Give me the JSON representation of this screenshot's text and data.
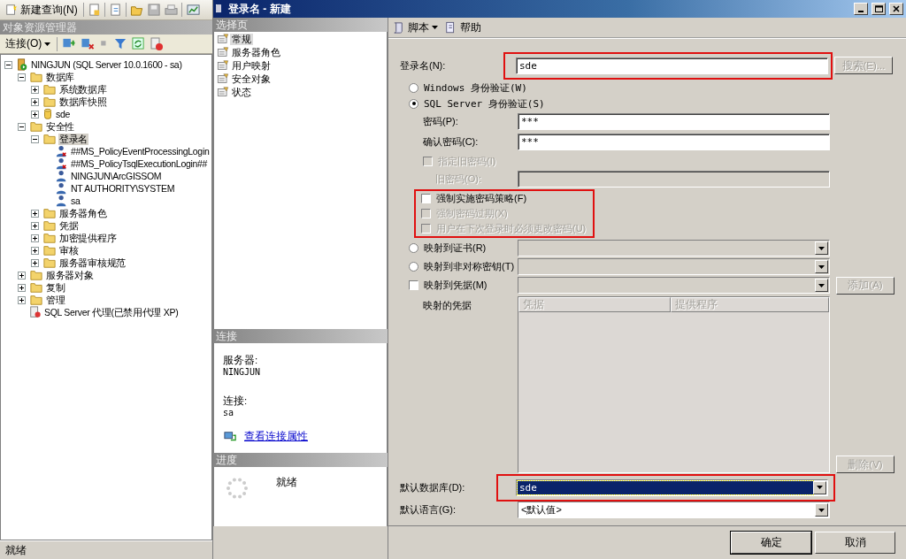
{
  "main_toolbar": {
    "new_query": "新建查询(N)"
  },
  "explorer": {
    "title": "对象资源管理器",
    "connect": "连接(O)",
    "tree": [
      {
        "kind": "server",
        "label": "NINGJUN (SQL Server 10.0.1600 - sa)",
        "expanded": true,
        "selected": false,
        "children": [
          {
            "kind": "folder",
            "label": "数据库",
            "expanded": true,
            "selected": false,
            "children": [
              {
                "kind": "folder",
                "label": "系统数据库",
                "expanded": false,
                "selected": false
              },
              {
                "kind": "folder",
                "label": "数据库快照",
                "expanded": false,
                "selected": false
              },
              {
                "kind": "database",
                "label": "sde",
                "expanded": false,
                "selected": false
              }
            ]
          },
          {
            "kind": "folder",
            "label": "安全性",
            "expanded": true,
            "selected": false,
            "children": [
              {
                "kind": "folder",
                "label": "登录名",
                "expanded": true,
                "selected": true,
                "children": [
                  {
                    "kind": "login-disabled",
                    "label": "##MS_PolicyEventProcessingLogin",
                    "selected": false
                  },
                  {
                    "kind": "login-disabled",
                    "label": "##MS_PolicyTsqlExecutionLogin##",
                    "selected": false
                  },
                  {
                    "kind": "login",
                    "label": "NINGJUN\\ArcGISSOM",
                    "selected": false
                  },
                  {
                    "kind": "login",
                    "label": "NT AUTHORITY\\SYSTEM",
                    "selected": false
                  },
                  {
                    "kind": "login",
                    "label": "sa",
                    "selected": false
                  }
                ]
              },
              {
                "kind": "folder",
                "label": "服务器角色",
                "expanded": false,
                "selected": false
              },
              {
                "kind": "folder",
                "label": "凭据",
                "expanded": false,
                "selected": false
              },
              {
                "kind": "folder",
                "label": "加密提供程序",
                "expanded": false,
                "selected": false
              },
              {
                "kind": "folder",
                "label": "审核",
                "expanded": false,
                "selected": false
              },
              {
                "kind": "folder",
                "label": "服务器审核规范",
                "expanded": false,
                "selected": false
              }
            ]
          },
          {
            "kind": "folder",
            "label": "服务器对象",
            "expanded": false,
            "selected": false
          },
          {
            "kind": "folder",
            "label": "复制",
            "expanded": false,
            "selected": false
          },
          {
            "kind": "folder",
            "label": "管理",
            "expanded": false,
            "selected": false
          },
          {
            "kind": "agent",
            "label": "SQL Server 代理(已禁用代理 XP)",
            "selected": false
          }
        ]
      }
    ]
  },
  "status_bar": "就绪",
  "dialog": {
    "title": "登录名 - 新建",
    "pages_header": "选择页",
    "pages": [
      {
        "label": "常规",
        "selected": true
      },
      {
        "label": "服务器角色",
        "selected": false
      },
      {
        "label": "用户映射",
        "selected": false
      },
      {
        "label": "安全对象",
        "selected": false
      },
      {
        "label": "状态",
        "selected": false
      }
    ],
    "connection_header": "连接",
    "server_label": "服务器:",
    "server": "NINGJUN",
    "connection_label": "连接:",
    "connection": "sa",
    "connection_link": "查看连接属性",
    "progress_header": "进度",
    "progress_status": "就绪"
  },
  "toolbar": {
    "script": "脚本",
    "help": "帮助"
  },
  "form": {
    "login_name": {
      "label": "登录名(N):",
      "value": "sde",
      "highlighted": true
    },
    "search_button": {
      "label": "搜索(E)...",
      "disabled": true
    },
    "auth_modes": [
      {
        "label": "Windows 身份验证(W)",
        "selected": false
      },
      {
        "label": "SQL Server 身份验证(S)",
        "selected": true
      }
    ],
    "password": {
      "label": "密码(P):",
      "value": "***"
    },
    "confirm_password": {
      "label": "确认密码(C):",
      "value": "***"
    },
    "specify_old_password": {
      "label": "指定旧密码(I)",
      "checked": false,
      "disabled": true
    },
    "old_password": {
      "label": "旧密码(O):",
      "disabled": true
    },
    "policy_highlighted": true,
    "policy_options": [
      {
        "label": "强制实施密码策略(F)",
        "checked": false,
        "disabled": false
      },
      {
        "label": "强制密码过期(X)",
        "checked": false,
        "disabled": true
      },
      {
        "label": "用户在下次登录时必须更改密码(U)",
        "checked": false,
        "disabled": true
      }
    ],
    "mappings": [
      {
        "kind": "radio",
        "label": "映射到证书(R)",
        "selected": false
      },
      {
        "kind": "radio",
        "label": "映射到非对称密钥(T)",
        "selected": false
      },
      {
        "kind": "checkbox",
        "label": "映射到凭据(M)",
        "checked": false
      }
    ],
    "add_button": {
      "label": "添加(A)",
      "disabled": true
    },
    "mapped_credentials": {
      "label": "映射的凭据",
      "columns": [
        "凭据",
        "提供程序"
      ]
    },
    "delete_button": {
      "label": "删除(V)",
      "disabled": true
    },
    "default_database": {
      "label": "默认数据库(D):",
      "value": "sde",
      "highlighted": true
    },
    "default_language": {
      "label": "默认语言(G):",
      "value": "<默认值>"
    }
  },
  "buttons": {
    "ok": "确定",
    "cancel": "取消"
  }
}
